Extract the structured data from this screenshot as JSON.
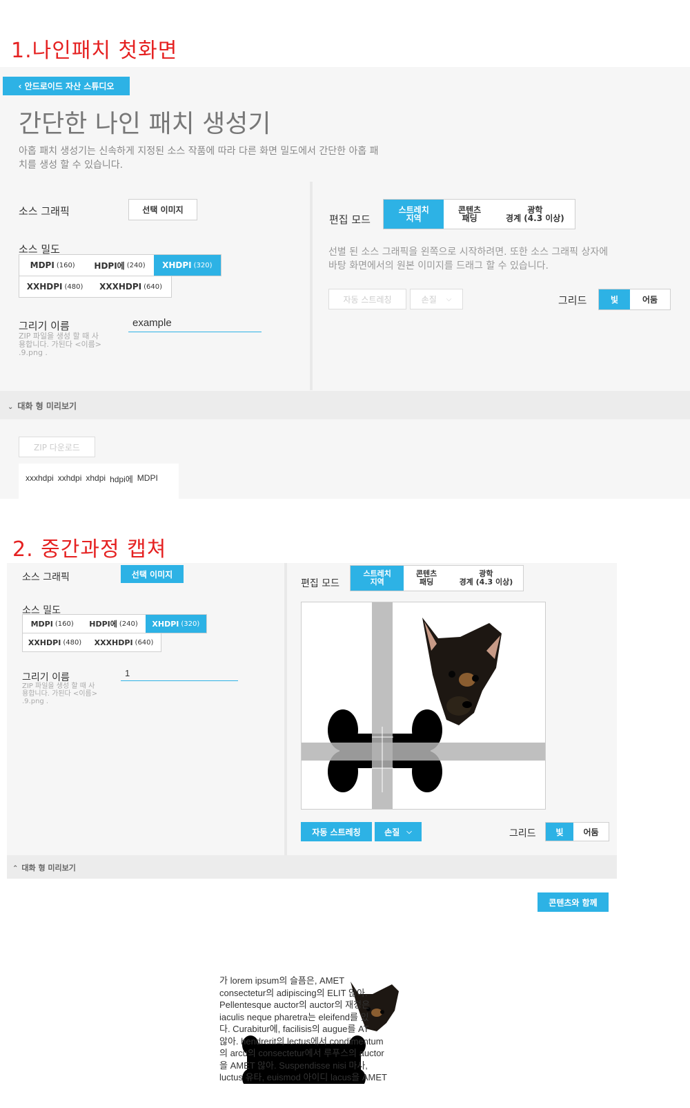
{
  "headings": {
    "first": "1.나인패치 첫화면",
    "second": "2. 중간과정 캡쳐"
  },
  "screen1": {
    "back_button": "‹ 안드로이드 자산 스튜디오",
    "title": "간단한 나인 패치 생성기",
    "description_line1": "아홉 패치 생성기는 신속하게 지정된 소스 작품에 따라 다른 화면 밀도에서 간단한 아홉 패",
    "description_line2": "치를 생성 할 수 있습니다.",
    "source_graphic_label": "소스 그래픽",
    "select_image_button": "선택 이미지",
    "density_label": "소스 밀도",
    "densities": [
      {
        "name": "MDPI",
        "value": "(160)"
      },
      {
        "name": "HDPI에",
        "value": "(240)"
      },
      {
        "name": "XHDPI",
        "value": "(320)"
      },
      {
        "name": "XXHDPI",
        "value": "(480)"
      },
      {
        "name": "XXXHDPI",
        "value": "(640)"
      }
    ],
    "selected_density": "XHDPI",
    "drawable_label": "그리기 이름",
    "drawable_hint_line1": "ZIP 파일을 생성 할 때 사",
    "drawable_hint_line2": "용합니다. 가된다 <이름>",
    "drawable_hint_line3": ".9.png .",
    "drawable_value": "example",
    "edit_mode_label": "편집 모드",
    "edit_modes": [
      {
        "line1": "스트레치",
        "line2": "지역"
      },
      {
        "line1": "콘텐츠",
        "line2": "패딩"
      },
      {
        "line1": "광학",
        "line2": "경계 (4.3 이상)"
      }
    ],
    "edit_instruction_line1": "선별 된 소스 그래픽을 왼쪽으로 시작하려면. 또한 소스 그래픽 상자에",
    "edit_instruction_line2": "바탕 화면에서의 원본 이미지를 드래그 할 수 있습니다.",
    "auto_stretch_button": "자동 스트레칭",
    "trim_button": "손질",
    "grid_label": "그리드",
    "grid_options": [
      "빛",
      "어둠"
    ],
    "preview_toggle": "대화 형 미리보기",
    "zip_download_button": "ZIP 다운로드",
    "download_densities": [
      "xxxhdpi",
      "xxhdpi",
      "xhdpi",
      "hdpi에",
      "MDPI"
    ]
  },
  "screen2": {
    "source_graphic_label": "소스 그래픽",
    "select_image_button": "선택 이미지",
    "density_label": "소스 밀도",
    "densities": [
      {
        "name": "MDPI",
        "value": "(160)"
      },
      {
        "name": "HDPI에",
        "value": "(240)"
      },
      {
        "name": "XHDPI",
        "value": "(320)"
      },
      {
        "name": "XXHDPI",
        "value": "(480)"
      },
      {
        "name": "XXXHDPI",
        "value": "(640)"
      }
    ],
    "drawable_label": "그리기 이름",
    "drawable_hint_line1": "ZIP 파일을 생성 할 때 사",
    "drawable_hint_line2": "용합니다. 가된다 <이름>",
    "drawable_hint_line3": ".9.png .",
    "drawable_value": "1",
    "edit_mode_label": "편집 모드",
    "edit_modes": [
      {
        "line1": "스트레치",
        "line2": "지역"
      },
      {
        "line1": "콘텐츠",
        "line2": "패딩"
      },
      {
        "line1": "광학",
        "line2": "경계 (4.3 이상)"
      }
    ],
    "auto_stretch_button": "자동 스트레칭",
    "trim_button": "손질",
    "grid_label": "그리드",
    "grid_options": [
      "빛",
      "어둠"
    ],
    "preview_toggle": "대화 형 미리보기",
    "with_content_button": "콘텐츠와 함께",
    "preview_lines": [
      "가 lorem ipsum의 슬픔은, AMET",
      "consectetur의 adipiscing의 ELIT 않아.",
      "Pellentesque auctor의 auctor의 재정은",
      "iaculis neque pharetra는 eleifend를 있",
      "다. Curabitur에, facilisis의 augue를 AT",
      "않아. hendrerit의 lectus에서 condimentum",
      "의 arcu의 consectetur에서 루푸스의 auctor",
      "을 AMET 않아. Suspendisse nisi 마사,",
      "luctus 유타, euismod 아이디 lacus을 AMET"
    ]
  },
  "colors": {
    "accent": "#2db2e5",
    "heading_red": "#e52121",
    "panel": "#f6f6f6"
  }
}
